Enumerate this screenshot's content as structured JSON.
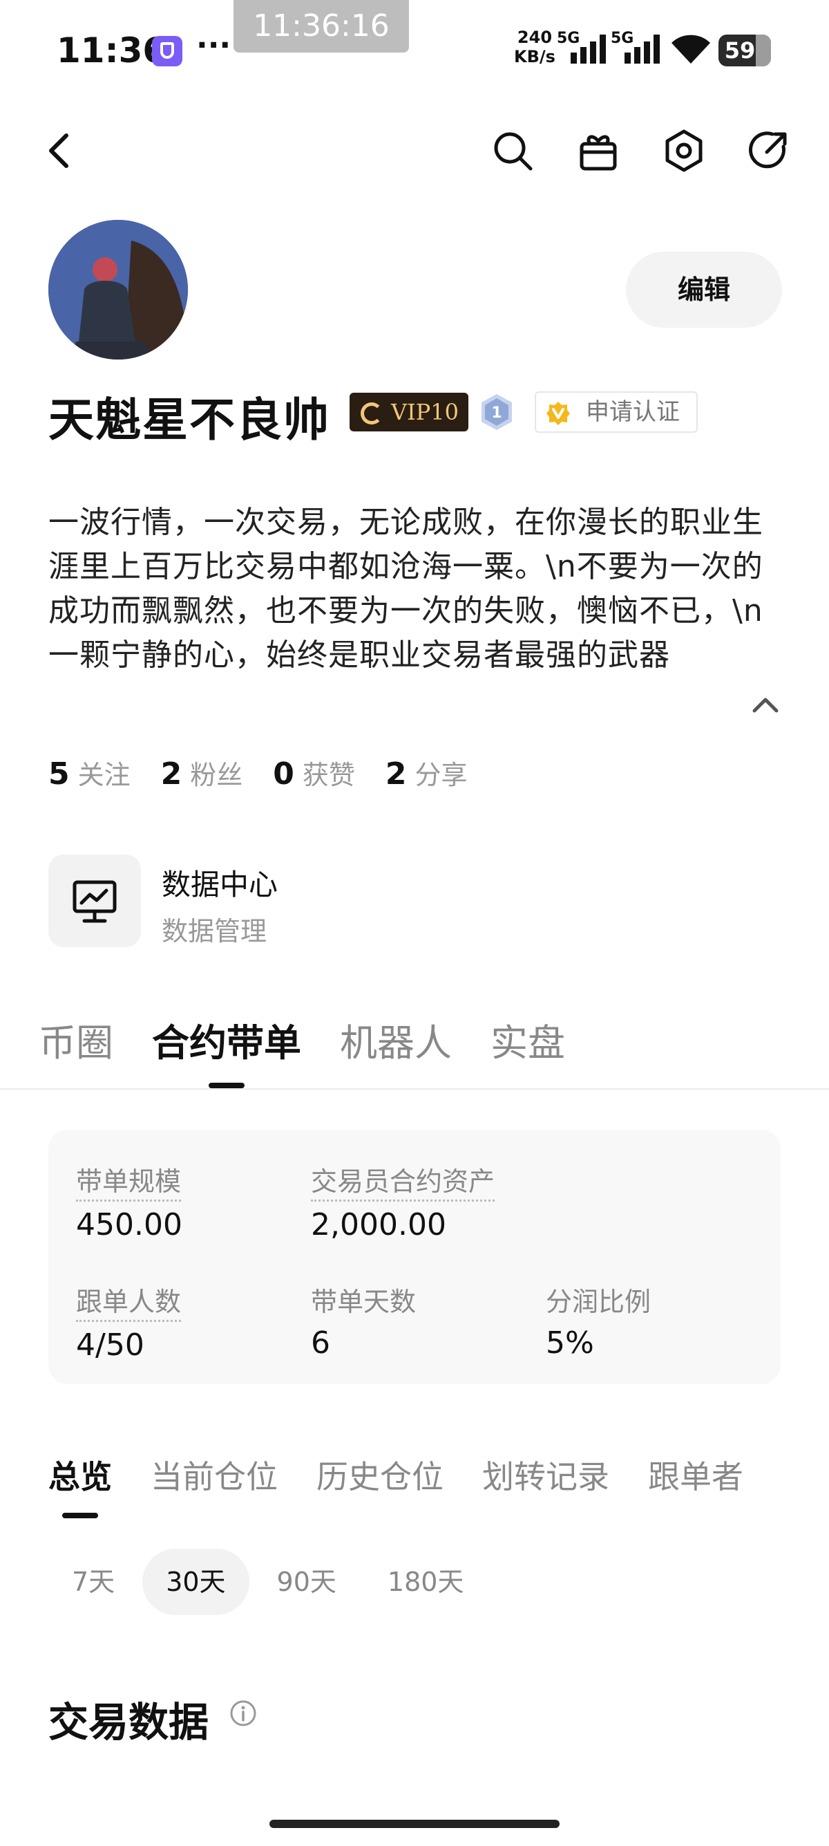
{
  "status_bar": {
    "time": "11:36",
    "more": "···",
    "clock_overlay": "11:36:16",
    "net_speed_value": "240",
    "net_speed_unit": "KB/s",
    "signal_1": "5G",
    "signal_2": "5G",
    "battery": "59"
  },
  "profile": {
    "name": "天魁星不良帅",
    "vip": "VIP10",
    "level": "1",
    "verify": "申请认证",
    "edit_label": "编辑",
    "bio": "一波行情，一次交易，无论成败，在你漫长的职业生涯里上百万比交易中都如沧海一粟。\\n不要为一次的成功而飘飘然，也不要为一次的失败，懊恼不已，\\n一颗宁静的心，始终是职业交易者最强的武器"
  },
  "stats": [
    {
      "value": "5",
      "label": "关注"
    },
    {
      "value": "2",
      "label": "粉丝"
    },
    {
      "value": "0",
      "label": "获赞"
    },
    {
      "value": "2",
      "label": "分享"
    }
  ],
  "data_center": {
    "title": "数据中心",
    "subtitle": "数据管理"
  },
  "main_tabs": [
    "币圈",
    "合约带单",
    "机器人",
    "实盘"
  ],
  "main_tab_active": "合约带单",
  "card": {
    "scale_label": "带单规模",
    "scale_value": "450.00",
    "asset_label": "交易员合约资产",
    "asset_value": "2,000.00",
    "followers_label": "跟单人数",
    "followers_value": "4/50",
    "days_label": "带单天数",
    "days_value": "6",
    "share_label": "分润比例",
    "share_value": "5%"
  },
  "sub_tabs": [
    "总览",
    "当前仓位",
    "历史仓位",
    "划转记录",
    "跟单者"
  ],
  "sub_tab_active": "总览",
  "ranges": [
    "7天",
    "30天",
    "90天",
    "180天"
  ],
  "range_active": "30天",
  "section": {
    "title": "交易数据"
  },
  "colors": {
    "vip_bg": "#2a1d12",
    "vip_text": "#f0c67a",
    "verify_gold": "#f5b81c",
    "level_blue": "#8fa8d8"
  }
}
